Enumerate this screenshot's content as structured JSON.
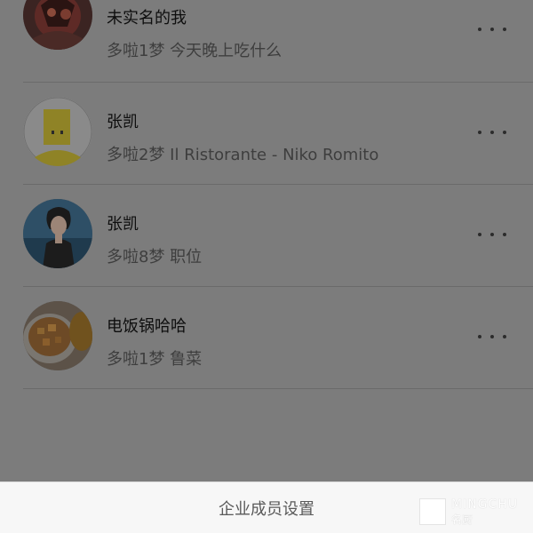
{
  "members": [
    {
      "name": "未实名的我",
      "subtitle": "多啦1梦 今天晚上吃什么",
      "avatar": "fantasy-character-avatar"
    },
    {
      "name": "张凯",
      "subtitle": "多啦2梦 Il Ristorante - Niko Romito",
      "avatar": "yellow-mascot-avatar"
    },
    {
      "name": "张凯",
      "subtitle": "多啦8梦 职位",
      "avatar": "person-photo-avatar"
    },
    {
      "name": "电饭锅哈哈",
      "subtitle": "多啦1梦 鲁菜",
      "avatar": "food-photo-avatar"
    }
  ],
  "more_icon": "ellipsis-icon",
  "bottom_sheet": {
    "action_label": "企业成员设置"
  },
  "watermark": {
    "text": "MINGCHU",
    "subtext": "名厨"
  }
}
